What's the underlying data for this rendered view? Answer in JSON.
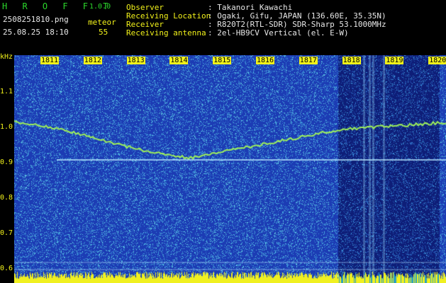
{
  "app": {
    "title": "H R O F F T",
    "version": "1.0.0",
    "filename": "2508251810.png",
    "datetime": "25.08.25 18:10",
    "mode_label": "meteor",
    "count": "55"
  },
  "info": {
    "observer_label": "Observer",
    "observer_value": ": Takanori Kawachi",
    "location_label": "Receiving Location",
    "location_value": ": Ogaki, Gifu, JAPAN (136.60E, 35.35N)",
    "receiver_label": "Receiver",
    "receiver_value": ": R820T2(RTL-SDR) SDR-Sharp 53.1000MHz",
    "antenna_label": "Receiving antenna",
    "antenna_value": ": 2el-HB9CV Vertical (el. E-W)"
  },
  "axis": {
    "unit": "kHz",
    "y_ticks": [
      "1.1",
      "1.0",
      "0.9",
      "0.8",
      "0.7",
      "0.6"
    ],
    "x_ticks": [
      "1811",
      "1812",
      "1813",
      "1814",
      "1815",
      "1816",
      "1817",
      "1818",
      "1819",
      "1820"
    ]
  },
  "colors": {
    "background": "#1c3cb4",
    "noise_high": "#56c8e6",
    "trace": "#9ef05a",
    "text_green": "#2bd62b",
    "text_yellow": "#f2f21a"
  }
}
